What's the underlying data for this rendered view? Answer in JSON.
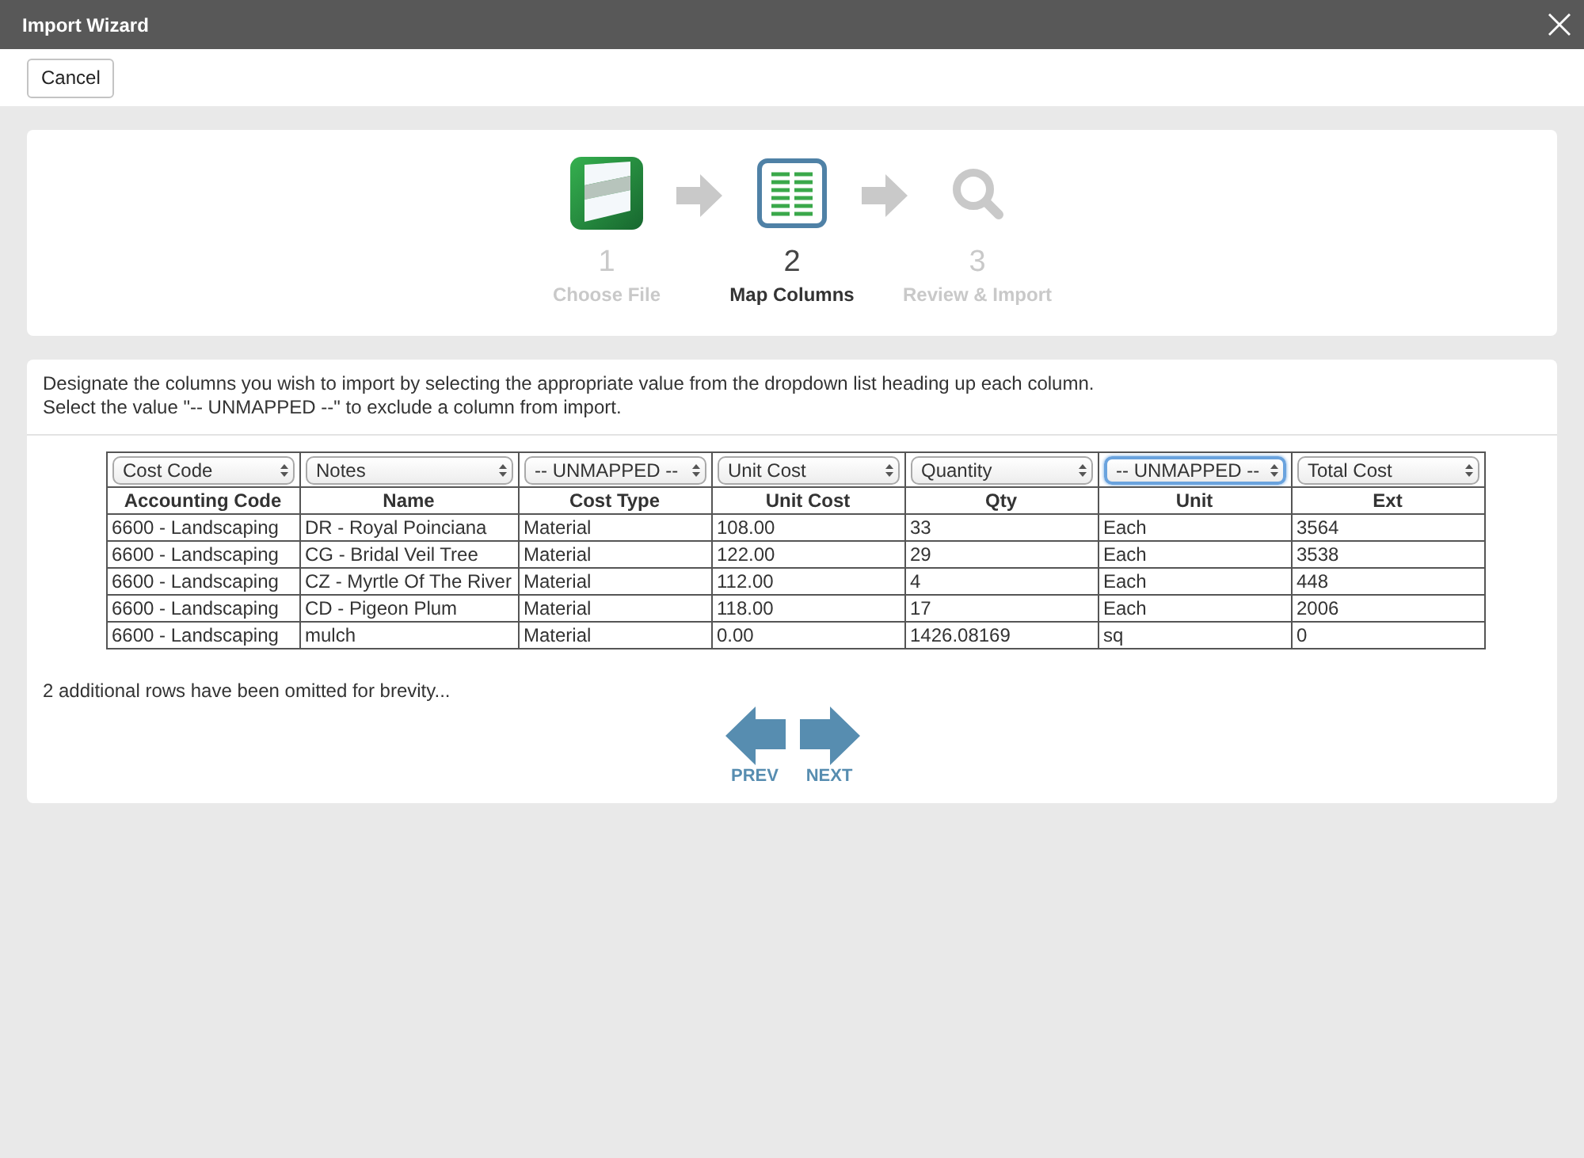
{
  "window": {
    "title": "Import Wizard",
    "buttons": [
      "Cancel"
    ]
  },
  "steps": [
    {
      "kind": "file",
      "number": "1",
      "label": "Choose File",
      "selected": false
    },
    {
      "kind": "columns",
      "number": "2",
      "label": "Map Columns",
      "selected": true
    },
    {
      "kind": "review",
      "number": "3",
      "label": "Review & Import",
      "selected": false
    }
  ],
  "instructions": [
    "Designate the columns you wish to import by selecting the appropriate value from the dropdown list heading up each column.",
    "Select the value \"-- UNMAPPED --\" to exclude a column from import."
  ],
  "table": {
    "columns": [
      {
        "mapping": "Cost Code",
        "heading": "Accounting Code",
        "focused": false
      },
      {
        "mapping": "Notes",
        "heading": "Name",
        "focused": false
      },
      {
        "mapping": "-- UNMAPPED --",
        "heading": "Cost Type",
        "focused": false
      },
      {
        "mapping": "Unit Cost",
        "heading": "Unit Cost",
        "focused": false
      },
      {
        "mapping": "Quantity",
        "heading": "Qty",
        "focused": false
      },
      {
        "mapping": "-- UNMAPPED --",
        "heading": "Unit",
        "focused": true
      },
      {
        "mapping": "Total Cost",
        "heading": "Ext",
        "focused": false
      }
    ],
    "rows": [
      [
        "6600 - Landscaping",
        "DR - Royal Poinciana",
        "Material",
        "108.00",
        "33",
        "Each",
        "3564"
      ],
      [
        "6600 - Landscaping",
        "CG - Bridal Veil Tree",
        "Material",
        "122.00",
        "29",
        "Each",
        "3538"
      ],
      [
        "6600 - Landscaping",
        "CZ - Myrtle Of The River",
        "Material",
        "112.00",
        "4",
        "Each",
        "448"
      ],
      [
        "6600 - Landscaping",
        "CD - Pigeon Plum",
        "Material",
        "118.00",
        "17",
        "Each",
        "2006"
      ],
      [
        "6600 - Landscaping",
        "mulch",
        "Material",
        "0.00",
        "1426.08169",
        "sq",
        "0"
      ]
    ]
  },
  "note": "2 additional rows have been omitted for brevity...",
  "navigation": [
    {
      "kind": "prev",
      "label": "PREV"
    },
    {
      "kind": "next",
      "label": "NEXT"
    }
  ]
}
